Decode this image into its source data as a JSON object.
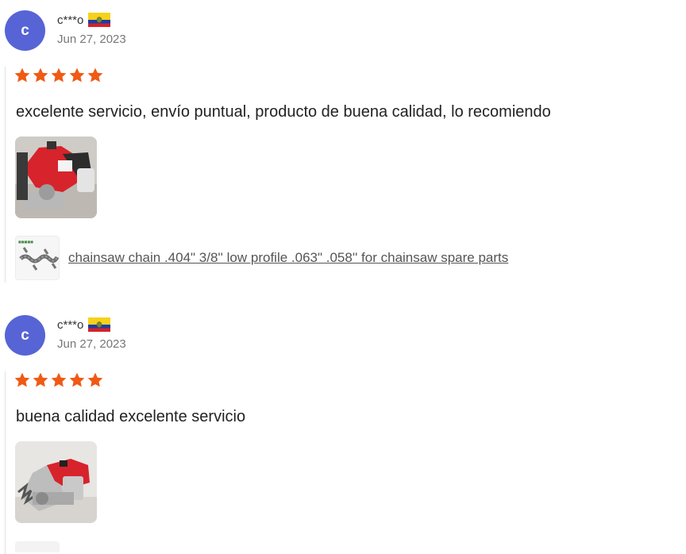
{
  "reviews": [
    {
      "avatar_letter": "c",
      "username": "c***o",
      "country_flag": "ecuador-flag-icon",
      "date": "Jun 27, 2023",
      "rating": 5,
      "comment": "excelente servicio, envío puntual, producto de buena calidad, lo recomiendo",
      "photo": "chainsaw-photo",
      "product_link": "chainsaw chain .404\" 3/8'' low profile .063\" .058'' for chainsaw spare parts"
    },
    {
      "avatar_letter": "c",
      "username": "c***o",
      "country_flag": "ecuador-flag-icon",
      "date": "Jun 27, 2023",
      "rating": 5,
      "comment": "buena calidad excelente servicio",
      "photo": "chainsaw-photo"
    }
  ],
  "colors": {
    "avatar_bg": "#5664d6",
    "star": "#f05a14",
    "link": "#555555"
  }
}
